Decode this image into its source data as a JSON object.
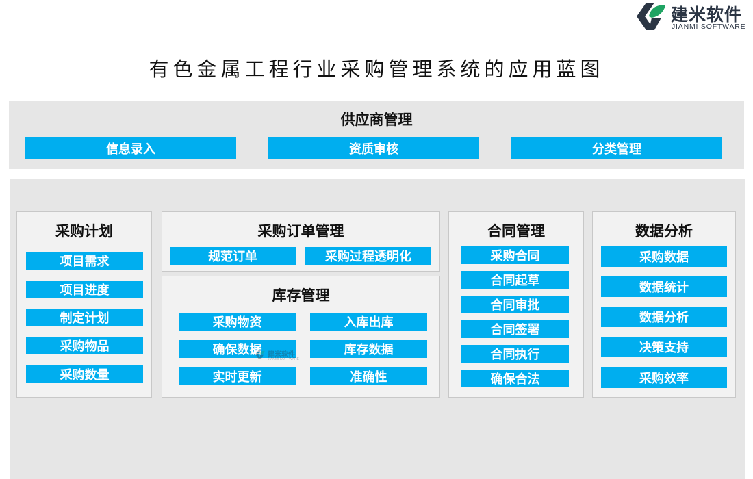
{
  "brand": {
    "name": "建米软件",
    "subtitle": "JIANMI SOFTWARE",
    "colors": {
      "dark": "#2b3544",
      "green": "#1fa463"
    }
  },
  "title": "有色金属工程行业采购管理系统的应用蓝图",
  "accent_color": "#00aeef",
  "supplier": {
    "title": "供应商管理",
    "items": [
      "信息录入",
      "资质审核",
      "分类管理"
    ]
  },
  "plan": {
    "title": "采购计划",
    "items": [
      "项目需求",
      "项目进度",
      "制定计划",
      "采购物品",
      "采购数量"
    ]
  },
  "order": {
    "title": "采购订单管理",
    "items": [
      "规范订单",
      "采购过程透明化"
    ]
  },
  "inventory": {
    "title": "库存管理",
    "items": [
      "采购物资",
      "入库出库",
      "确保数据",
      "库存数据",
      "实时更新",
      "准确性"
    ]
  },
  "contract": {
    "title": "合同管理",
    "items": [
      "采购合同",
      "合同起草",
      "合同审批",
      "合同签署",
      "合同执行",
      "确保合法"
    ]
  },
  "analysis": {
    "title": "数据分析",
    "items": [
      "采购数据",
      "数据统计",
      "数据分析",
      "决策支持",
      "采购效率"
    ]
  }
}
